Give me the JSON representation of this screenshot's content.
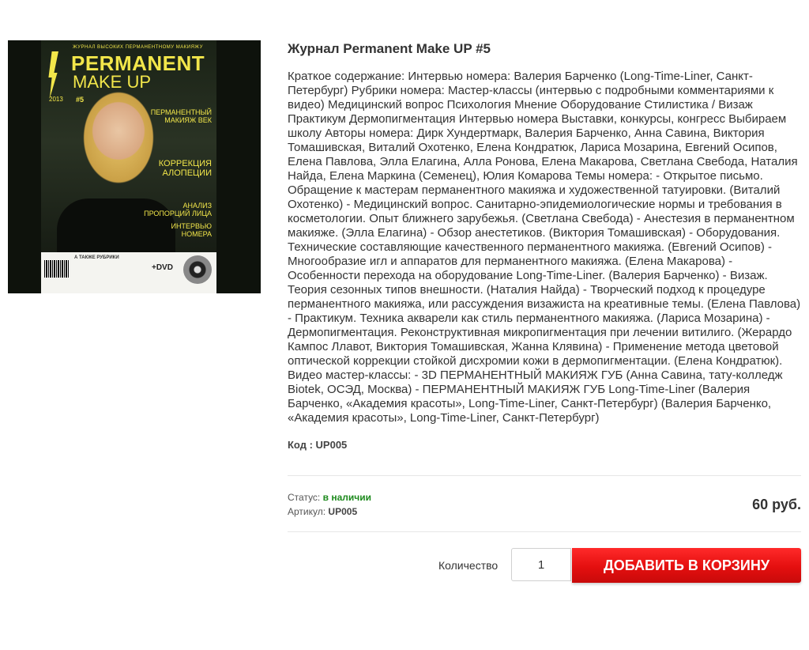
{
  "product": {
    "title": "Журнал Permanent Make UP #5",
    "description": "Краткое содержание: Интервью номера: Валерия Барченко (Long-Time-Liner, Санкт-Петербург) Рубрики номера: Мастер-классы (интервью с подробными комментариями к видео) Медицинский вопрос Психология Мнение Оборудование Стилистика / Визаж Практикум Дермопигментация Интервью номера Выставки, конкурсы, конгресс Выбираем школу Авторы номера: Дирк Хундертмарк, Валерия Барченко, Анна Савина, Виктория Томашивская, Виталий Охотенко, Елена Кондратюк, Лариса Мозарина, Евгений Осипов, Елена Павлова, Элла Елагина, Алла Ронова, Елена Макарова, Светлана Свебода, Наталия Найда, Елена Маркина (Семенец), Юлия Комарова Темы номера: - Открытое письмо. Обращение к мастерам перманентного макияжа и художественной татуировки. (Виталий Охотенко) - Медицинский вопрос. Санитарно-эпидемиологические нормы и требования в косметологии. Опыт ближнего зарубежья. (Светлана Свебода) - Анестезия в перманентном макияже. (Элла Елагина) - Обзор анестетиков. (Виктория Томашивская) - Оборудования. Технические составляющие качественного перманентного макияжа. (Евгений Осипов) - Многообразие игл и аппаратов для перманентного макияжа. (Елена Макарова) - Особенности перехода на оборудование Long-Time-Liner. (Валерия Барченко) - Визаж. Теория сезонных типов внешности. (Наталия Найда) - Творческий подход к процедуре перманентного макияжа, или рассуждения визажиста на креативные темы. (Елена Павлова) - Практикум. Техника акварели как стиль перманентного макияжа. (Лариса Мозарина) - Дермопигментация. Реконструктивная микропигментация при лечении витилиго. (Жерардо Кампос Ллавот, Виктория Томашивская, Жанна Клявина) - Применение метода цветовой оптической коррекции стойкой дисхромии кожи в дермопигментации. (Елена Кондратюк). Видео мастер-классы: - 3D ПЕРМАНЕНТНЫЙ МАКИЯЖ ГУБ (Анна Савина, тату-колледж Biotek, ОСЭД, Москва) - ПЕРМАНЕНТНЫЙ МАКИЯЖ ГУБ Long-Time-Liner (Валерия Барченко, «Академия красоты», Long-Time-Liner, Санкт-Петербург) (Валерия Барченко, «Академия красоты», Long-Time-Liner, Санкт-Петербург)",
    "code_label": "Код :",
    "code_value": "UP005",
    "status_label": "Статус:",
    "status_value": "в наличии",
    "article_label": "Артикул:",
    "article_value": "UP005",
    "price": "60 руб.",
    "quantity_label": "Количество",
    "quantity_value": "1",
    "add_to_cart_label": "ДОБАВИТЬ В КОРЗИНУ"
  },
  "cover": {
    "top_line": "ЖУРНАЛ ВЫСОКИХ ПЕРМАНЕНТНОМУ МАКИЯЖУ",
    "brand_line1": "PERMANENT",
    "brand_line2": "MAKE UP",
    "year": "2013",
    "issue": "#5",
    "headline1": "ПЕРМАНЕНТНЫЙ МАКИЯЖ ВЕК",
    "headline2": "КОРРЕКЦИЯ АЛОПЕЦИИ",
    "headline3": "АНАЛИЗ ПРОПОРЦИЙ ЛИЦА",
    "headline4": "ИНТЕРВЬЮ НОМЕРА",
    "rubrics": "А ТАКЖЕ РУБРИКИ",
    "dvd": "+DVD"
  },
  "colors": {
    "accent": "#e40f0f",
    "status_ok": "#1d8a1d",
    "cover_yellow": "#f2e64a"
  }
}
